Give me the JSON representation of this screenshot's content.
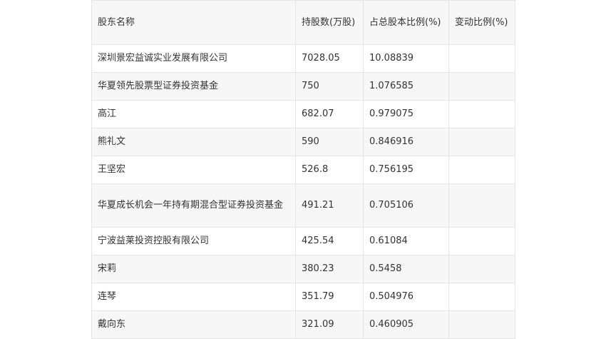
{
  "table": {
    "headers": [
      "股东名称",
      "持股数(万股)",
      "占总股本比例(%)",
      "变动比例(%)"
    ],
    "rows": [
      [
        "深圳景宏益诚实业发展有限公司",
        "7028.05",
        "10.08839",
        ""
      ],
      [
        "华夏领先股票型证券投资基金",
        "750",
        "1.076585",
        ""
      ],
      [
        "高江",
        "682.07",
        "0.979075",
        ""
      ],
      [
        "熊礼文",
        "590",
        "0.846916",
        ""
      ],
      [
        "王坚宏",
        "526.8",
        "0.756195",
        ""
      ],
      [
        "华夏成长机会一年持有期混合型证券投资基金",
        "491.21",
        "0.705106",
        ""
      ],
      [
        "宁波益莱投资控股有限公司",
        "425.54",
        "0.61084",
        ""
      ],
      [
        "宋莉",
        "380.23",
        "0.5458",
        ""
      ],
      [
        "连琴",
        "351.79",
        "0.504976",
        ""
      ],
      [
        "戴向东",
        "321.09",
        "0.460905",
        ""
      ]
    ]
  }
}
